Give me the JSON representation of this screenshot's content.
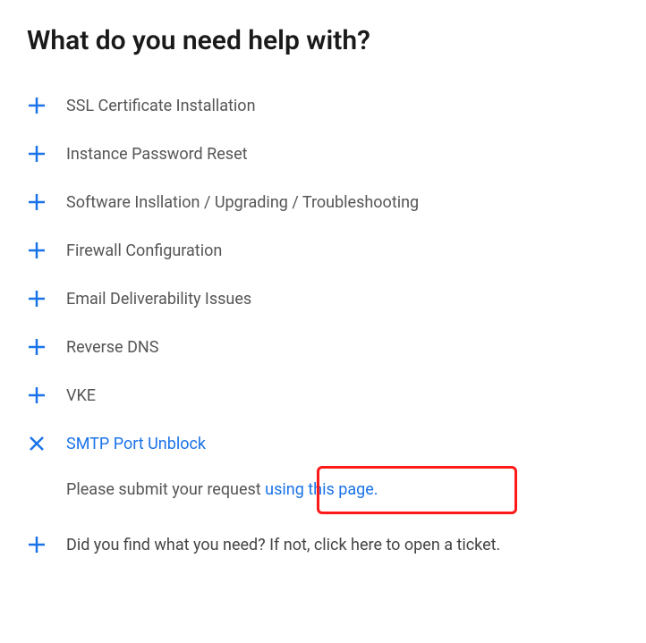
{
  "title": "What do you need help with?",
  "items": [
    {
      "label": "SSL Certificate Installation",
      "expanded": false
    },
    {
      "label": "Instance Password Reset",
      "expanded": false
    },
    {
      "label": "Software Insllation / Upgrading / Troubleshooting",
      "expanded": false
    },
    {
      "label": "Firewall Configuration",
      "expanded": false
    },
    {
      "label": "Email Deliverability Issues",
      "expanded": false
    },
    {
      "label": "Reverse DNS",
      "expanded": false
    },
    {
      "label": "VKE",
      "expanded": false
    },
    {
      "label": "SMTP Port Unblock",
      "expanded": true
    }
  ],
  "expanded_content": {
    "prefix": "Please submit your request ",
    "link_text": "using this page."
  },
  "final_item": {
    "label": "Did you find what you need? If not, click here to open a ticket."
  }
}
